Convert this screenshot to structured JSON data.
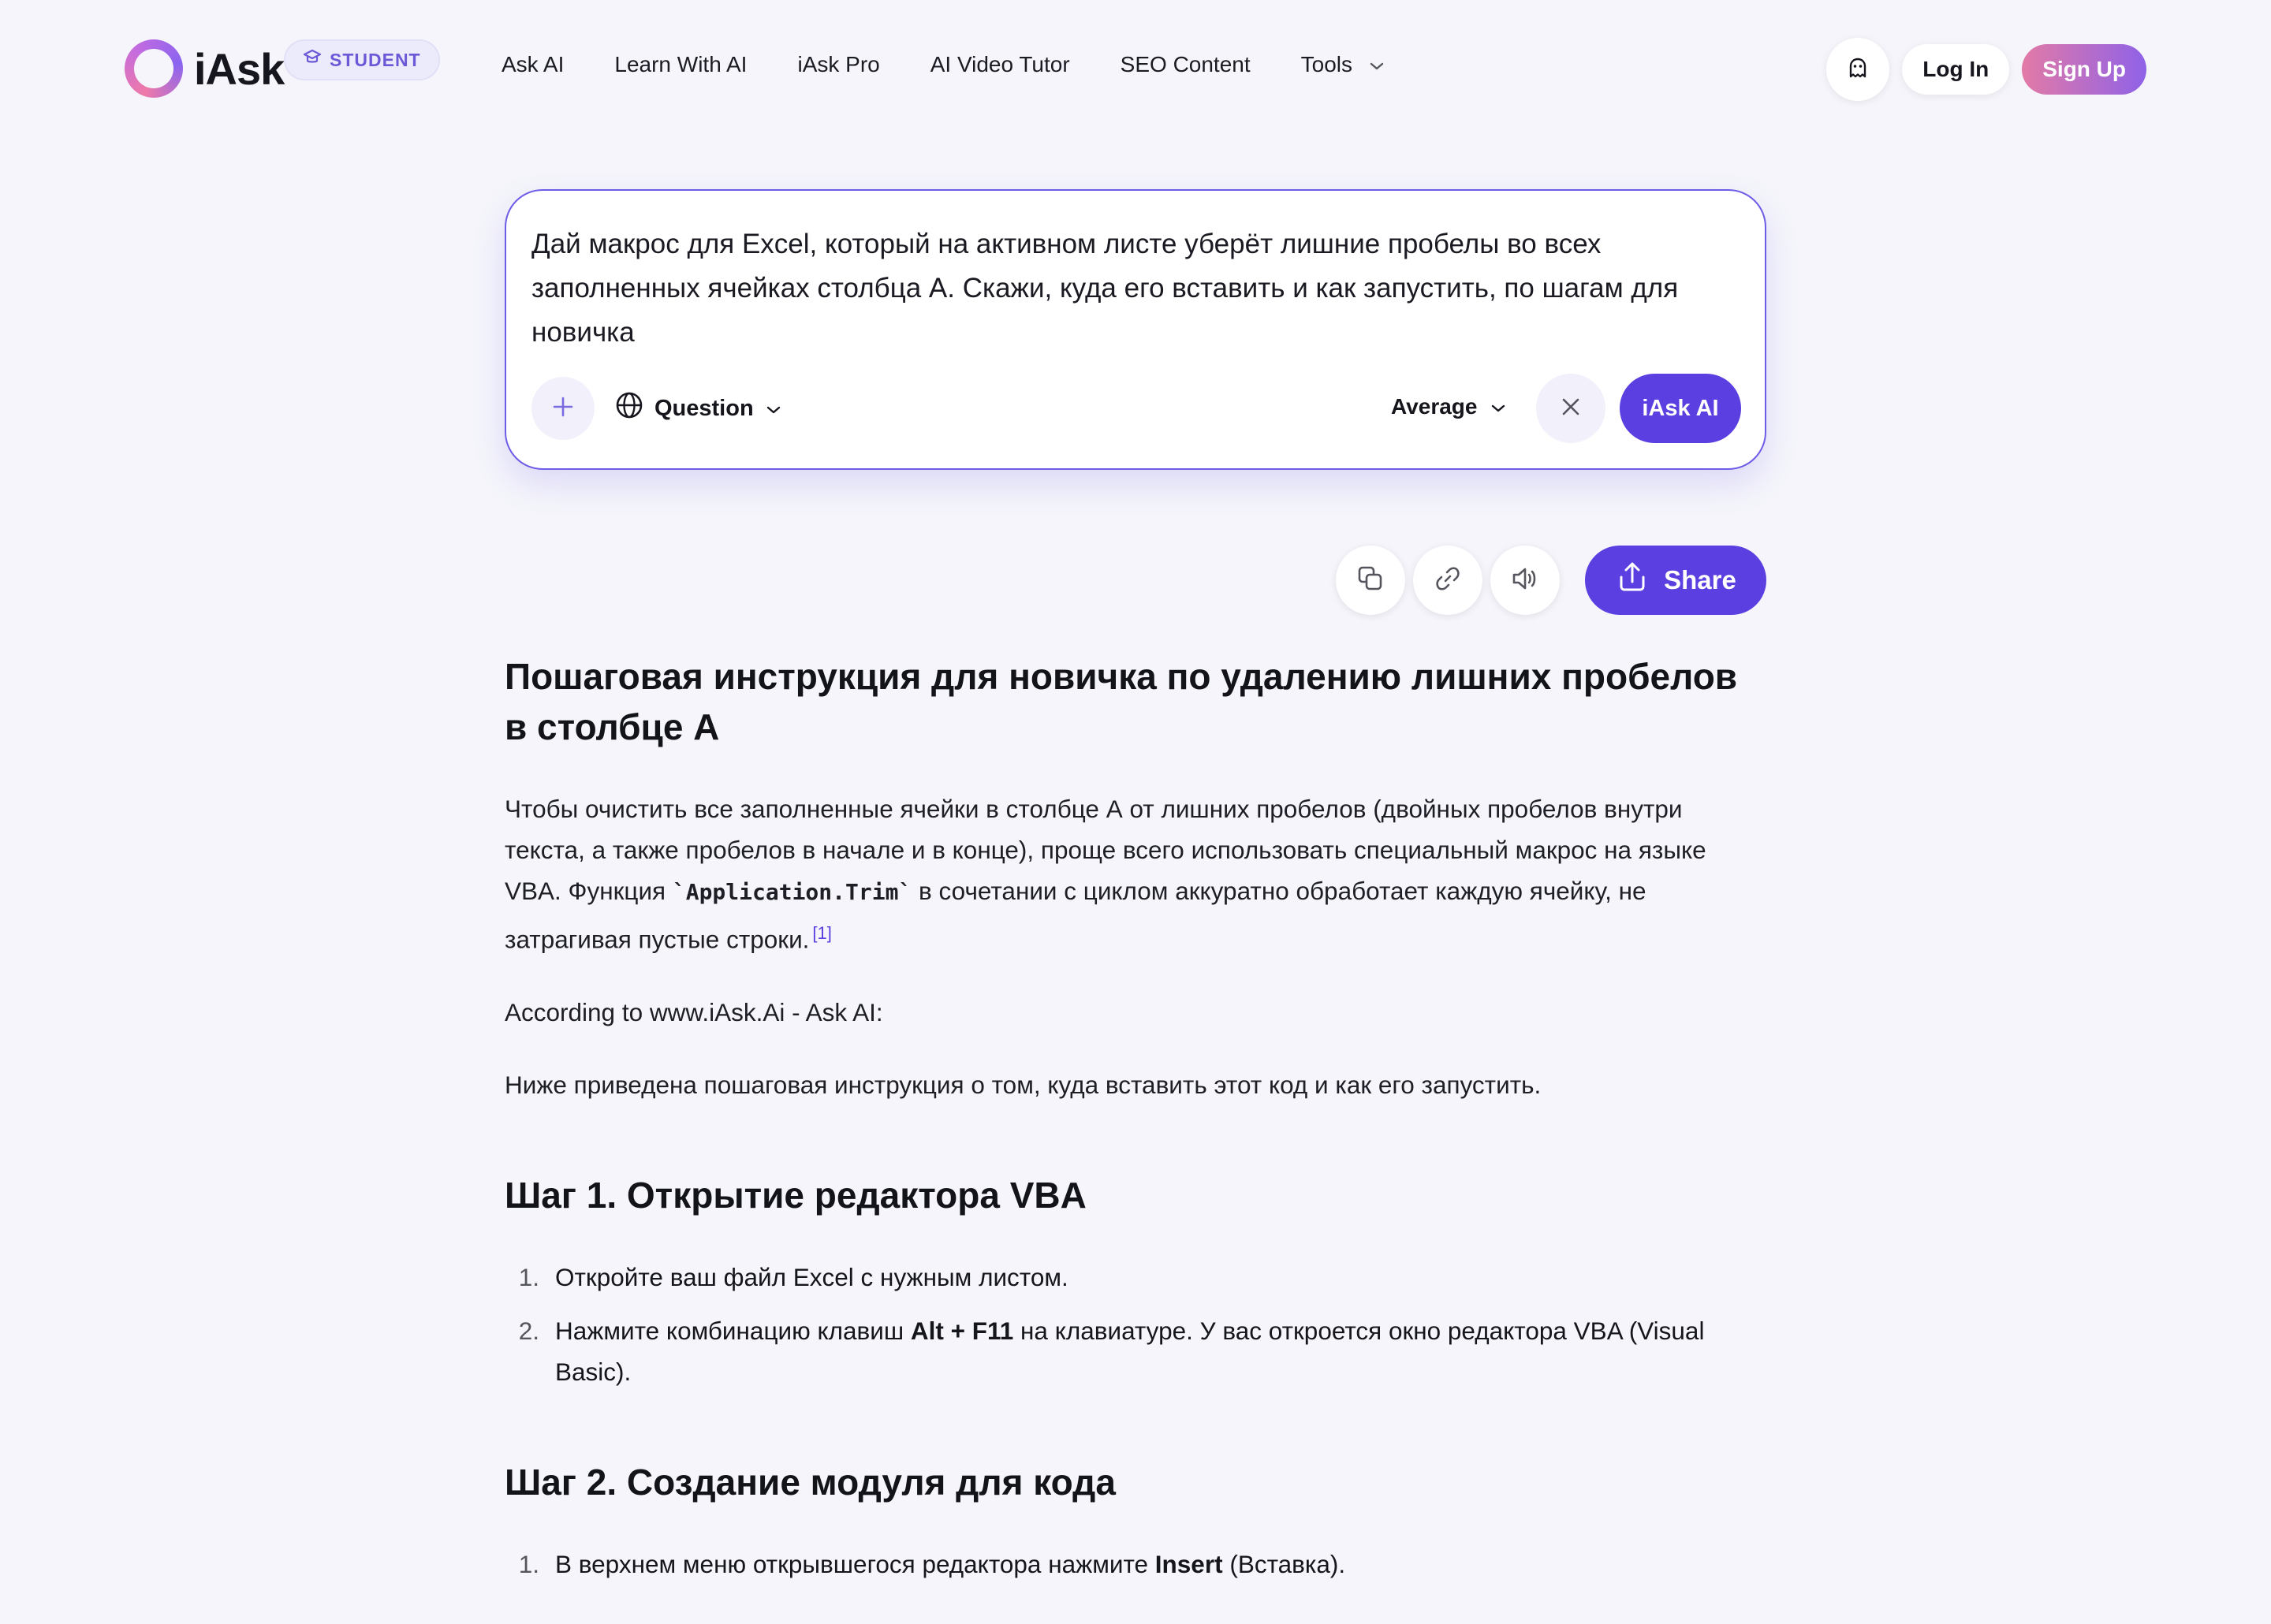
{
  "header": {
    "logo_text": "iAsk",
    "badge": "STUDENT",
    "nav": [
      "Ask AI",
      "Learn With AI",
      "iAsk Pro",
      "AI Video Tutor",
      "SEO Content"
    ],
    "tools_label": "Tools",
    "login_label": "Log In",
    "signup_label": "Sign Up"
  },
  "search": {
    "query": "Дай макрос для Excel, который на активном листе уберёт лишние пробелы во всех заполненных ячейках столбца A. Скажи, куда его вставить и как запустить, по шагам для новичка",
    "mode_label": "Question",
    "level_label": "Average",
    "submit_label": "iAsk AI"
  },
  "actions": {
    "share_label": "Share"
  },
  "answer": {
    "title": "Пошаговая инструкция для новичка по удалению лишних пробелов в столбце A",
    "intro_part1": "Чтобы очистить все заполненные ячейки в столбце А от лишних пробелов (двойных пробелов внутри текста, а также пробелов в начале и в конце), проще всего использовать специальный макрос на языке VBA. Функция ",
    "intro_code": "`Application.Trim`",
    "intro_part2": " в сочетании с циклом аккуратно обработает каждую ячейку, не затрагивая пустые строки.",
    "citation": "[1]",
    "source_line": "According to www.iAsk.Ai - Ask AI:",
    "lead": "Ниже приведена пошаговая инструкция о том, куда вставить этот код и как его запустить.",
    "step1": {
      "heading": "Шаг 1. Открытие редактора VBA",
      "items": [
        {
          "num": "1.",
          "before": "Откройте ваш файл Excel с нужным листом.",
          "bold": "",
          "after": ""
        },
        {
          "num": "2.",
          "before": "Нажмите комбинацию клавиш ",
          "bold": "Alt + F11",
          "after": " на клавиатуре. У вас откроется окно редактора VBA (Visual Basic)."
        }
      ]
    },
    "step2": {
      "heading": "Шаг 2. Создание модуля для кода",
      "items": [
        {
          "num": "1.",
          "before": "В верхнем меню открывшегося редактора нажмите ",
          "bold": "Insert",
          "after": " (Вставка)."
        }
      ]
    }
  },
  "colors": {
    "accent": "#5b3fe0",
    "background": "#f5f5fb",
    "signup_gradient_start": "#e37aa6",
    "signup_gradient_end": "#8f62e8"
  },
  "icons": [
    "student-cap-icon",
    "chevron-down-icon",
    "ghost-icon",
    "plus-icon",
    "globe-icon",
    "close-icon",
    "copy-icon",
    "link-icon",
    "speaker-icon",
    "upload-icon"
  ]
}
